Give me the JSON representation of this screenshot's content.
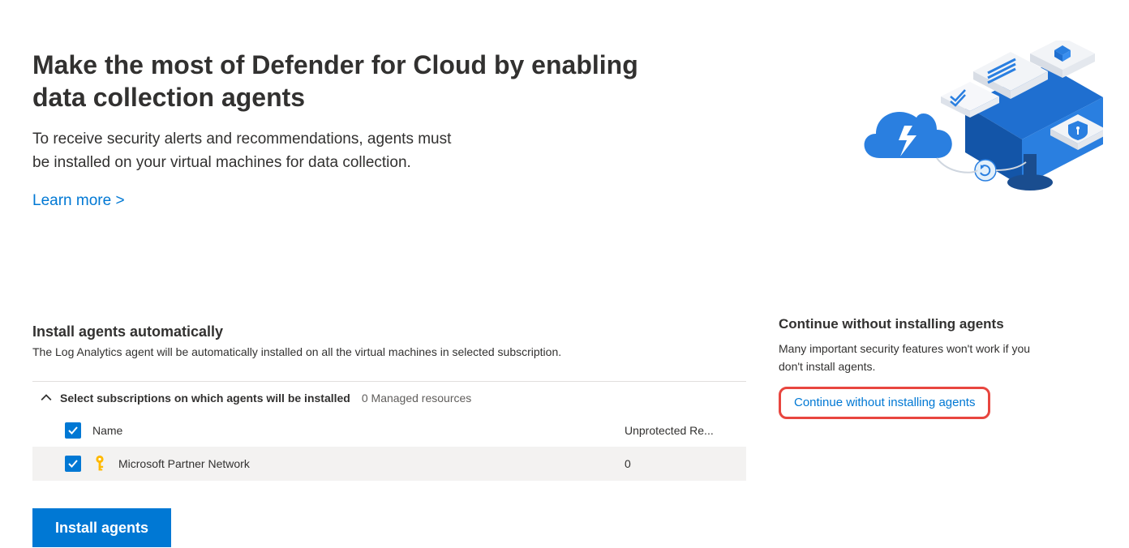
{
  "header": {
    "title": "Make the most of Defender for Cloud by enabling data collection agents",
    "subtitle_line1": "To receive security alerts and recommendations, agents must",
    "subtitle_line2": "be installed on your virtual machines for data collection.",
    "learn_more": "Learn more >"
  },
  "install": {
    "title": "Install agents automatically",
    "description": "The Log Analytics agent will be automatically installed on all the virtual machines in selected subscription.",
    "expander_label": "Select subscriptions on which agents will be installed",
    "resources_count": "0 Managed resources",
    "columns": {
      "name": "Name",
      "unprotected": "Unprotected Re..."
    },
    "rows": [
      {
        "name": "Microsoft Partner Network",
        "unprotected": "0"
      }
    ],
    "button": "Install agents"
  },
  "continue": {
    "title": "Continue without installing agents",
    "description": "Many important security features won't work if you don't install agents.",
    "link": "Continue without installing agents"
  }
}
